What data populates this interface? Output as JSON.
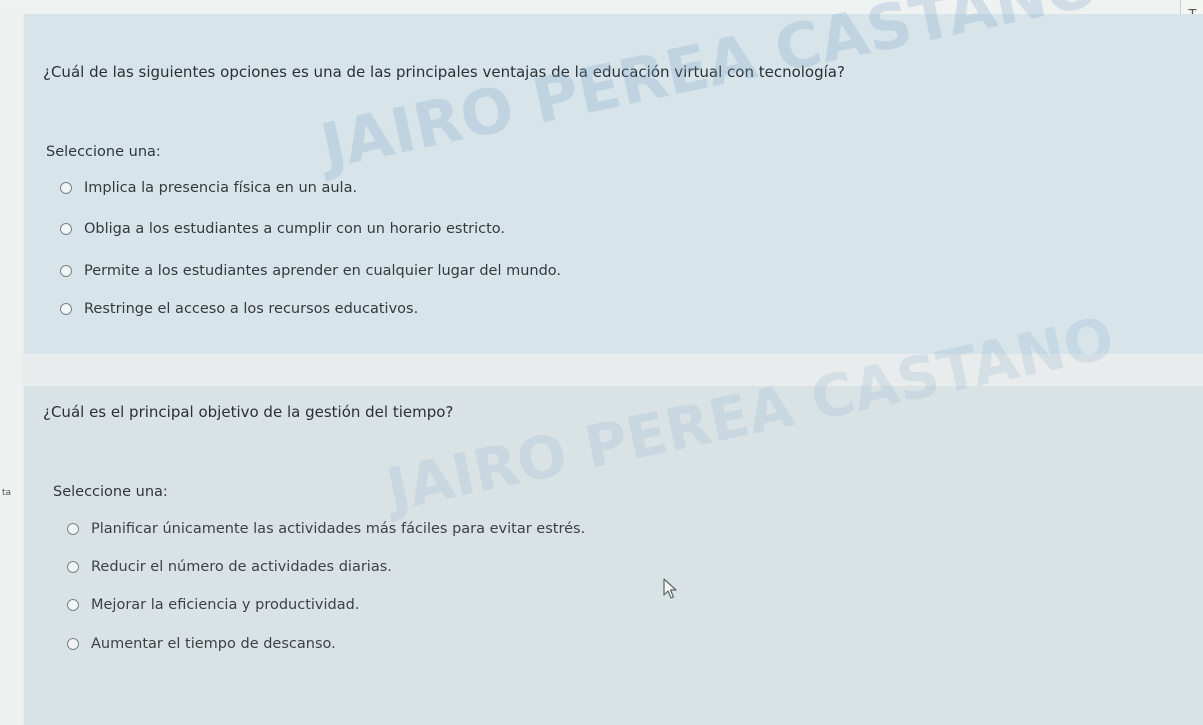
{
  "corner_label": "T",
  "sidebar_fragment": "ta",
  "questions": [
    {
      "text": "¿Cuál de las siguientes opciones es una de las principales ventajas de la educación virtual con tecnología?",
      "select_label": "Seleccione una:",
      "options": [
        "Implica la presencia física en un aula.",
        "Obliga a los estudiantes a cumplir con un horario estricto.",
        "Permite a los estudiantes aprender en cualquier lugar del mundo.",
        "Restringe el acceso a los recursos educativos."
      ]
    },
    {
      "text": "¿Cuál es el principal objetivo de la gestión del tiempo?",
      "select_label": "Seleccione una:",
      "options": [
        "Planificar únicamente las actividades más fáciles para evitar estrés.",
        "Reducir el número de actividades diarias.",
        "Mejorar la eficiencia y productividad.",
        "Aumentar el tiempo de descanso."
      ]
    }
  ],
  "watermark": "JAIRO PEREA CASTANO"
}
